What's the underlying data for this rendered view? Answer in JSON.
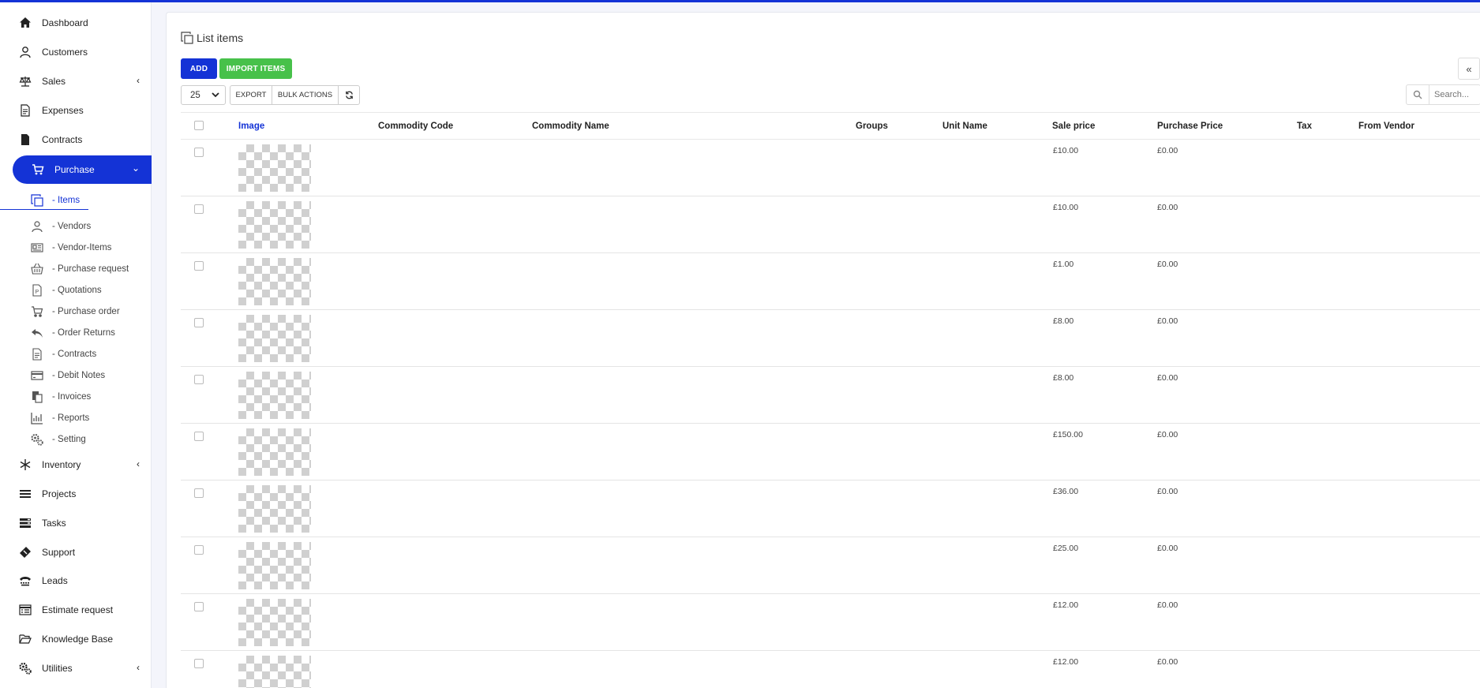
{
  "sidebar": {
    "items": [
      {
        "label": "Dashboard"
      },
      {
        "label": "Customers"
      },
      {
        "label": "Sales",
        "chevron": "‹"
      },
      {
        "label": "Expenses"
      },
      {
        "label": "Contracts"
      },
      {
        "label": "Purchase",
        "chevron": "⌄"
      },
      {
        "label": "Inventory",
        "chevron": "‹"
      },
      {
        "label": "Projects"
      },
      {
        "label": "Tasks"
      },
      {
        "label": "Support"
      },
      {
        "label": "Leads"
      },
      {
        "label": "Estimate request"
      },
      {
        "label": "Knowledge Base"
      },
      {
        "label": "Utilities",
        "chevron": "‹"
      }
    ],
    "purchase_sub": [
      {
        "label": "- Items"
      },
      {
        "label": "- Vendors"
      },
      {
        "label": "- Vendor-Items"
      },
      {
        "label": "- Purchase request"
      },
      {
        "label": "- Quotations"
      },
      {
        "label": "- Purchase order"
      },
      {
        "label": "- Order Returns"
      },
      {
        "label": "- Contracts"
      },
      {
        "label": "- Debit Notes"
      },
      {
        "label": "- Invoices"
      },
      {
        "label": "- Reports"
      },
      {
        "label": "- Setting"
      }
    ]
  },
  "main": {
    "title": "List items",
    "add_label": "ADD",
    "import_label": "IMPORT ITEMS",
    "collapse_label": "«",
    "page_size": "25",
    "export_label": "EXPORT",
    "bulk_label": "BULK ACTIONS",
    "search_placeholder": "Search..."
  },
  "table": {
    "columns": [
      "Image",
      "Commodity Code",
      "Commodity Name",
      "Groups",
      "Unit Name",
      "Sale price",
      "Purchase Price",
      "Tax",
      "From Vendor"
    ],
    "rows": [
      {
        "sale": "£10.00",
        "purchase": "£0.00"
      },
      {
        "sale": "£10.00",
        "purchase": "£0.00"
      },
      {
        "sale": "£1.00",
        "purchase": "£0.00"
      },
      {
        "sale": "£8.00",
        "purchase": "£0.00"
      },
      {
        "sale": "£8.00",
        "purchase": "£0.00"
      },
      {
        "sale": "£150.00",
        "purchase": "£0.00"
      },
      {
        "sale": "£36.00",
        "purchase": "£0.00"
      },
      {
        "sale": "£25.00",
        "purchase": "£0.00"
      },
      {
        "sale": "£12.00",
        "purchase": "£0.00"
      },
      {
        "sale": "£12.00",
        "purchase": "£0.00"
      }
    ]
  },
  "colors": {
    "accent": "#1433d6",
    "import": "#47c14a"
  }
}
